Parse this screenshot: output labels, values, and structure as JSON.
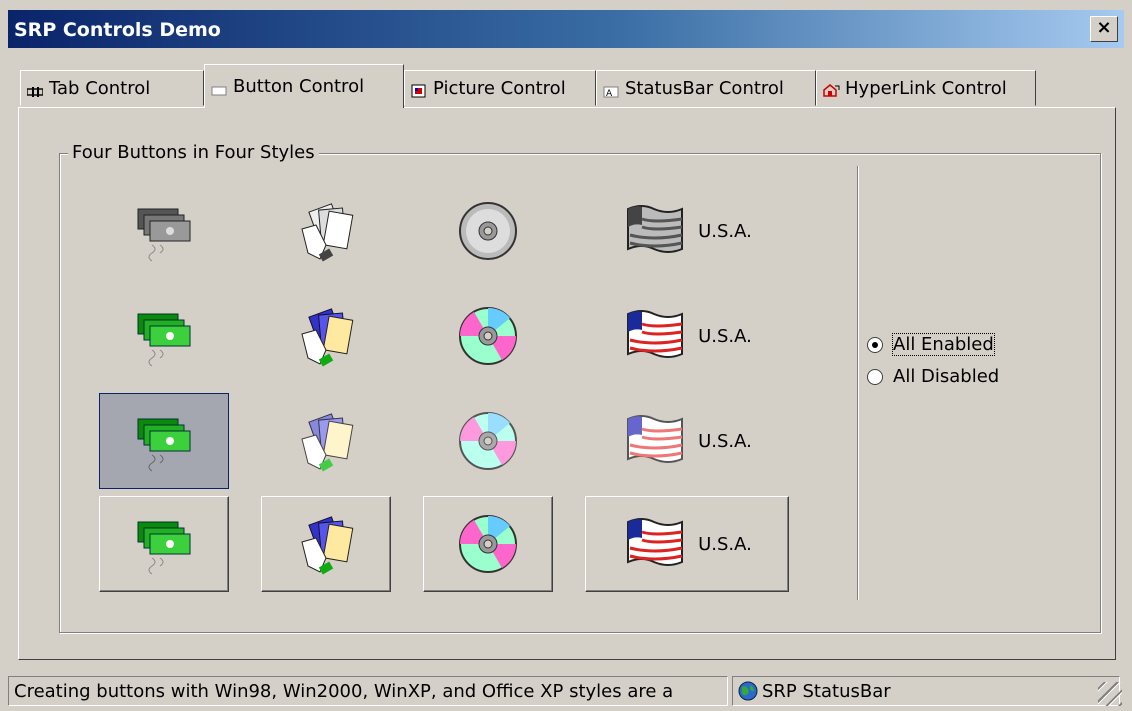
{
  "window": {
    "title": "SRP Controls Demo",
    "close_label": "×"
  },
  "tabs": [
    {
      "label": "Tab Control",
      "icon": "tab-icon"
    },
    {
      "label": "Button Control",
      "icon": "button-icon"
    },
    {
      "label": "Picture Control",
      "icon": "picture-icon"
    },
    {
      "label": "StatusBar Control",
      "icon": "statusbar-icon"
    },
    {
      "label": "HyperLink Control",
      "icon": "hyperlink-icon"
    }
  ],
  "active_tab": "Button Control",
  "group": {
    "title": "Four Buttons in Four Styles",
    "flag_label": "U.S.A.",
    "rows": [
      {
        "style": "disabled"
      },
      {
        "style": "flat"
      },
      {
        "style": "hot"
      },
      {
        "style": "raised"
      }
    ],
    "icons": [
      "money-icon",
      "cards-icon",
      "cd-icon",
      "flag-icon"
    ]
  },
  "options": {
    "enabled_label": "All Enabled",
    "disabled_label": "All Disabled",
    "selected": "All Enabled"
  },
  "status": {
    "message": "Creating buttons with Win98, Win2000, WinXP, and Office XP styles are a",
    "panel2": "SRP StatusBar"
  },
  "colors": {
    "title_start": "#0a246a",
    "title_end": "#a6caf0",
    "face": "#d4d0c8"
  }
}
